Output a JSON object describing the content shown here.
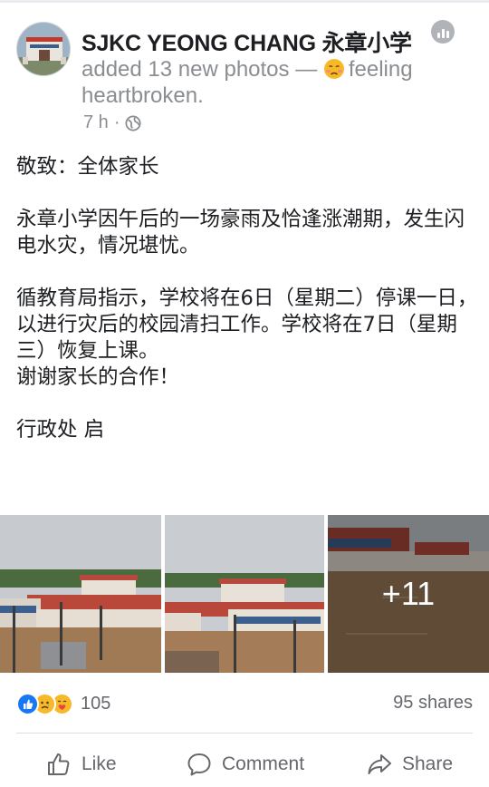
{
  "post": {
    "page_name": "SJKC YEONG CHANG 永章小学",
    "action_text": "added 13 new photos — ",
    "feeling_emoji": "sad-face-emoji",
    "feeling_text": "feeling heartbroken.",
    "time": "7 h",
    "separator": "·",
    "privacy_icon": "globe-icon",
    "body": {
      "salutation": "敬致：全体家长",
      "paragraph1": "永章小学因午后的一场豪雨及恰逢涨潮期，发生闪电水灾，情况堪忧。",
      "paragraph2": "循教育局指示，学校将在6日（星期二）停课一日，以进行灾后的校园清扫工作。学校将在7日（星期三）恢复上课。",
      "paragraph3": "谢谢家长的合作！",
      "signature": "行政处 启"
    },
    "photos": {
      "more_count": "+11"
    },
    "engagement": {
      "reactions": [
        "like",
        "sad",
        "care"
      ],
      "reaction_count": "105",
      "shares": "95 shares"
    },
    "actions": {
      "like": "Like",
      "comment": "Comment",
      "share": "Share"
    }
  },
  "colors": {
    "text": "#1c1e21",
    "secondary": "#8a8d91",
    "meta": "#65676b",
    "like_blue": "#1877f2",
    "sad_yellow": "#f7b928"
  }
}
